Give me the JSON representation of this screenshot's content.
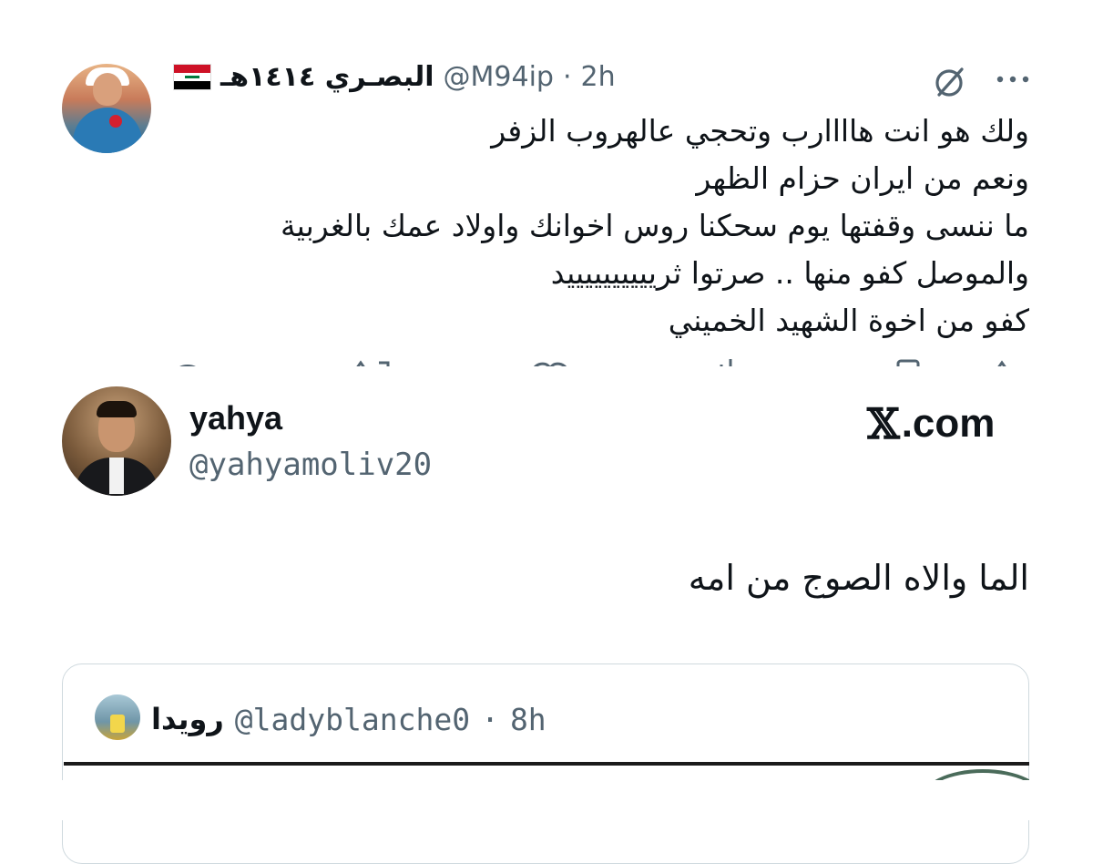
{
  "top_tweet": {
    "display_name": "البصـري ١٤١٤هـ",
    "flag_icon": "iraq-flag-icon",
    "handle": "@M94ip",
    "separator": "·",
    "time": "2h",
    "lines": [
      "ولك هو انت هاااارب وتحجي عالهروب الزفر",
      "ونعم من ايران حزام الظهر",
      "ما ننسى وقفتها يوم سحكنا روس اخوانك واولاد عمك بالغربية",
      "والموصل كفو منها .. صرتوا ثرييييييييييد",
      "كفو من اخوة الشهيد الخميني"
    ]
  },
  "quote_author": {
    "display_name": "yahya",
    "handle": "@yahyamoliv20"
  },
  "watermark": {
    "mark": "𝕏",
    "suffix": ".com"
  },
  "quote_text": "الما والاه الصوج من امه",
  "inner_quote": {
    "display_name": "رويدا",
    "handle": "@ladyblanche0",
    "separator": "·",
    "time": "8h"
  },
  "colors": {
    "text": "#0f1419",
    "muted": "#536471",
    "border": "#cfd9de"
  }
}
